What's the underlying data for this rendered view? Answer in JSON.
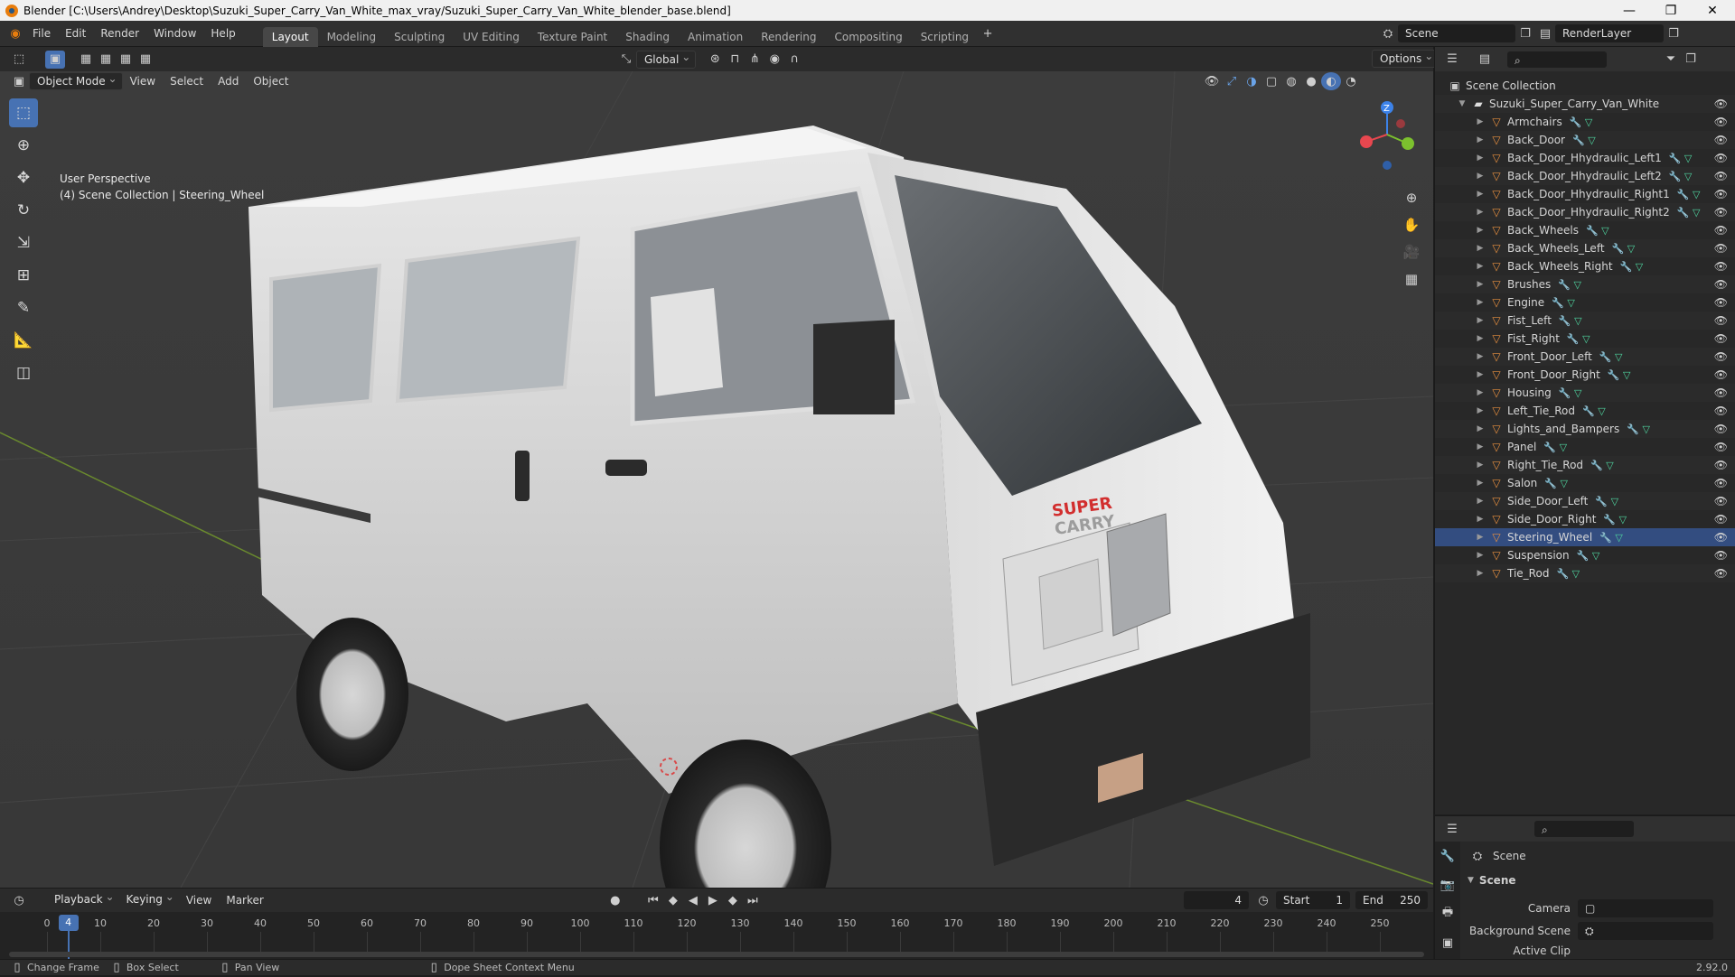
{
  "window": {
    "title": "Blender [C:\\Users\\Andrey\\Desktop\\Suzuki_Super_Carry_Van_White_max_vray/Suzuki_Super_Carry_Van_White_blender_base.blend]"
  },
  "menu": [
    "File",
    "Edit",
    "Render",
    "Window",
    "Help"
  ],
  "workspaces": [
    {
      "label": "Layout",
      "active": true
    },
    {
      "label": "Modeling"
    },
    {
      "label": "Sculpting"
    },
    {
      "label": "UV Editing"
    },
    {
      "label": "Texture Paint"
    },
    {
      "label": "Shading"
    },
    {
      "label": "Animation"
    },
    {
      "label": "Rendering"
    },
    {
      "label": "Compositing"
    },
    {
      "label": "Scripting"
    }
  ],
  "scene_name": "Scene",
  "render_layer": "RenderLayer",
  "viewport_header": {
    "transform_orientation": "Global",
    "options_label": "Options",
    "mode": "Object Mode",
    "menus": [
      "View",
      "Select",
      "Add",
      "Object"
    ]
  },
  "viewport": {
    "perspective_label": "User Perspective",
    "context_label": "(4) Scene Collection | Steering_Wheel",
    "logo_top": "SUPER",
    "logo_bottom": "CARRY"
  },
  "gizmo": {
    "z_label": "Z",
    "x_color": "#e8474f",
    "y_color": "#7cc12e",
    "z_color": "#3c82e8"
  },
  "outliner": {
    "root": "Scene Collection",
    "collection": "Suzuki_Super_Carry_Van_White",
    "items": [
      "Armchairs",
      "Back_Door",
      "Back_Door_Hhydraulic_Left1",
      "Back_Door_Hhydraulic_Left2",
      "Back_Door_Hhydraulic_Right1",
      "Back_Door_Hhydraulic_Right2",
      "Back_Wheels",
      "Back_Wheels_Left",
      "Back_Wheels_Right",
      "Brushes",
      "Engine",
      "Fist_Left",
      "Fist_Right",
      "Front_Door_Left",
      "Front_Door_Right",
      "Housing",
      "Left_Tie_Rod",
      "Lights_and_Bampers",
      "Panel",
      "Right_Tie_Rod",
      "Salon",
      "Side_Door_Left",
      "Side_Door_Right",
      "Steering_Wheel",
      "Suspension",
      "Tie_Rod"
    ]
  },
  "properties": {
    "tab": "Scene",
    "panel": "Scene",
    "camera_label": "Camera",
    "background_label": "Background Scene",
    "clip_label": "Active Clip",
    "version": "2.92.0"
  },
  "timeline": {
    "menus": [
      "Playback",
      "Keying",
      "View",
      "Marker"
    ],
    "current_frame": "4",
    "start_label": "Start",
    "start": "1",
    "end_label": "End",
    "end": "250",
    "ticks": [
      "0",
      "10",
      "20",
      "30",
      "40",
      "50",
      "60",
      "70",
      "80",
      "90",
      "100",
      "110",
      "120",
      "130",
      "140",
      "150",
      "160",
      "170",
      "180",
      "190",
      "200",
      "210",
      "220",
      "230",
      "240",
      "250"
    ]
  },
  "statusbar": {
    "change_frame": "Change Frame",
    "box_select": "Box Select",
    "pan_view": "Pan View",
    "context_menu": "Dope Sheet Context Menu"
  }
}
